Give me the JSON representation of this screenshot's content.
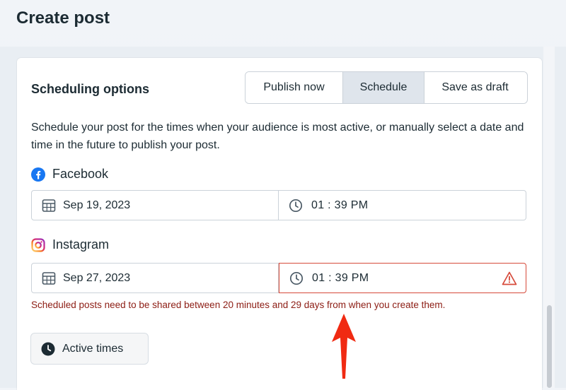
{
  "page": {
    "title": "Create post"
  },
  "scheduling": {
    "title": "Scheduling options",
    "options": [
      {
        "label": "Publish now"
      },
      {
        "label": "Schedule",
        "selected": true
      },
      {
        "label": "Save as draft"
      }
    ],
    "description": "Schedule your post for the times when your audience is most active, or manually select a date and time in the future to publish your post."
  },
  "facebook": {
    "label": "Facebook",
    "date": "Sep 19, 2023",
    "time": "01 : 39 PM",
    "icon": "facebook-icon",
    "brand_color": "#1877f2"
  },
  "instagram": {
    "label": "Instagram",
    "date": "Sep 27, 2023",
    "time": "01 : 39 PM",
    "icon": "instagram-icon",
    "error": "Scheduled posts need to be shared between 20 minutes and 29 days from when you create them."
  },
  "active_times": {
    "label": "Active times",
    "icon": "clock-icon"
  },
  "colors": {
    "error_border": "#d64a3a",
    "error_text": "#8c1c13",
    "selected_segment": "#dfe5ec",
    "annotation_arrow": "#f02a12"
  }
}
